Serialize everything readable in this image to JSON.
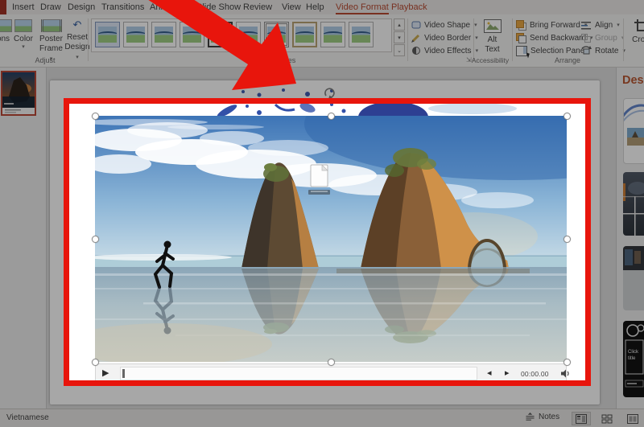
{
  "accent": {
    "annotation_red": "#e8150c",
    "contextual_tab_red": "#b5432a",
    "designer_title_orange": "#b5502a"
  },
  "menu_bar": {
    "items": [
      "Insert",
      "Draw",
      "Design",
      "Transitions",
      "Animations",
      "Slide Show",
      "Review",
      "View",
      "Help"
    ]
  },
  "contextual_tabs": {
    "video_format": "Video Format",
    "playback": "Playback"
  },
  "ribbon": {
    "adjust": {
      "corrections_partial": "ons",
      "color": "Color",
      "poster_line1": "Poster",
      "poster_line2": "Frame",
      "reset_line1": "Reset",
      "reset_line2": "Design",
      "group_label": "Adjust"
    },
    "styles_group_label": "Styles",
    "video_menu": {
      "shape": "Video Shape",
      "border": "Video Border",
      "effects": "Video Effects"
    },
    "accessibility": {
      "alt_line1": "Alt",
      "alt_line2": "Text",
      "group_label": "Accessibility"
    },
    "arrange": {
      "bring_forward": "Bring Forward",
      "send_backward": "Send Backward",
      "selection_pane": "Selection Pane",
      "align": "Align",
      "group": "Group",
      "rotate": "Rotate",
      "group_label": "Arrange"
    },
    "crop_label": "Crop"
  },
  "icons": {
    "caret": "▾",
    "gallery_up": "▴",
    "gallery_down": "▾",
    "gallery_more": "⌄",
    "play": "▶",
    "frame_back": "◂",
    "frame_fwd": "▸",
    "dialog_launcher": "⇲",
    "reset_arrow": "↶"
  },
  "video_player": {
    "time": "00:00.00"
  },
  "design_panel": {
    "title": "Desig",
    "dark_card": {
      "line1": "Click",
      "line2": "title"
    }
  },
  "status_bar": {
    "language": "Vietnamese",
    "notes": "Notes"
  }
}
